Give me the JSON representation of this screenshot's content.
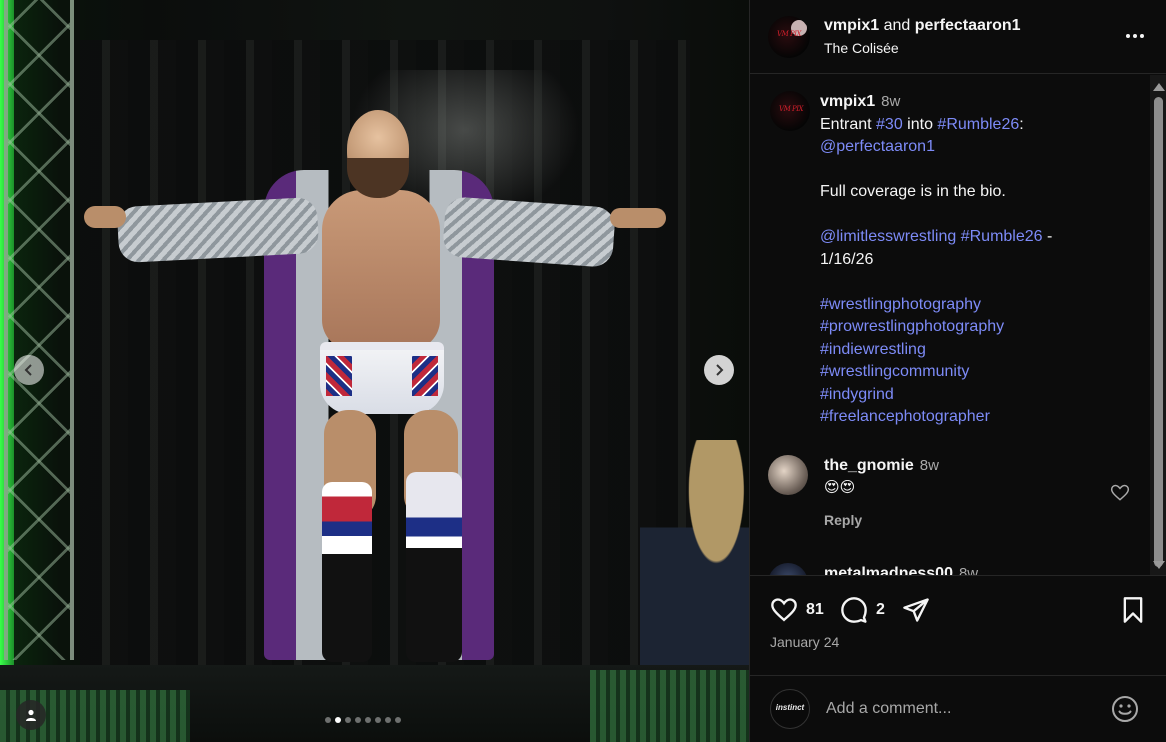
{
  "header": {
    "user1": "vmpix1",
    "joiner": "and",
    "user2": "perfectaaron1",
    "location": "The Colisée"
  },
  "post": {
    "username": "vmpix1",
    "age": "8w",
    "caption": {
      "l1a": "Entrant ",
      "l1b": "#30",
      "l1c": " into ",
      "l1d": "#Rumble26",
      "l1e": ":",
      "l2": "@perfectaaron1",
      "l3": "Full coverage is in the bio.",
      "l4a": "@limitlesswrestling",
      "l4b": "#Rumble26",
      "l4c": " -",
      "l5": "1/16/26",
      "hashtags": [
        "#wrestlingphotography",
        "#prowrestlingphotography",
        "#indiewrestling",
        "#wrestlingcommunity",
        "#indygrind",
        "#freelancephotographer"
      ]
    }
  },
  "comments": [
    {
      "username": "the_gnomie",
      "age": "8w",
      "text": "😍😍",
      "reply": "Reply"
    },
    {
      "username": "metalmadness00",
      "age": "8w"
    }
  ],
  "actions": {
    "likes": "81",
    "comments": "2",
    "date": "January 24"
  },
  "add_comment": {
    "placeholder": "Add a comment...",
    "avatar_text": "instinct"
  },
  "media": {
    "avatar_logo_text": "VM PIX",
    "carousel_dots": 8,
    "active_dot": 1
  },
  "colors": {
    "link": "#7d8bf7",
    "background": "#0c0c0c",
    "muted": "#a8a8a8"
  }
}
